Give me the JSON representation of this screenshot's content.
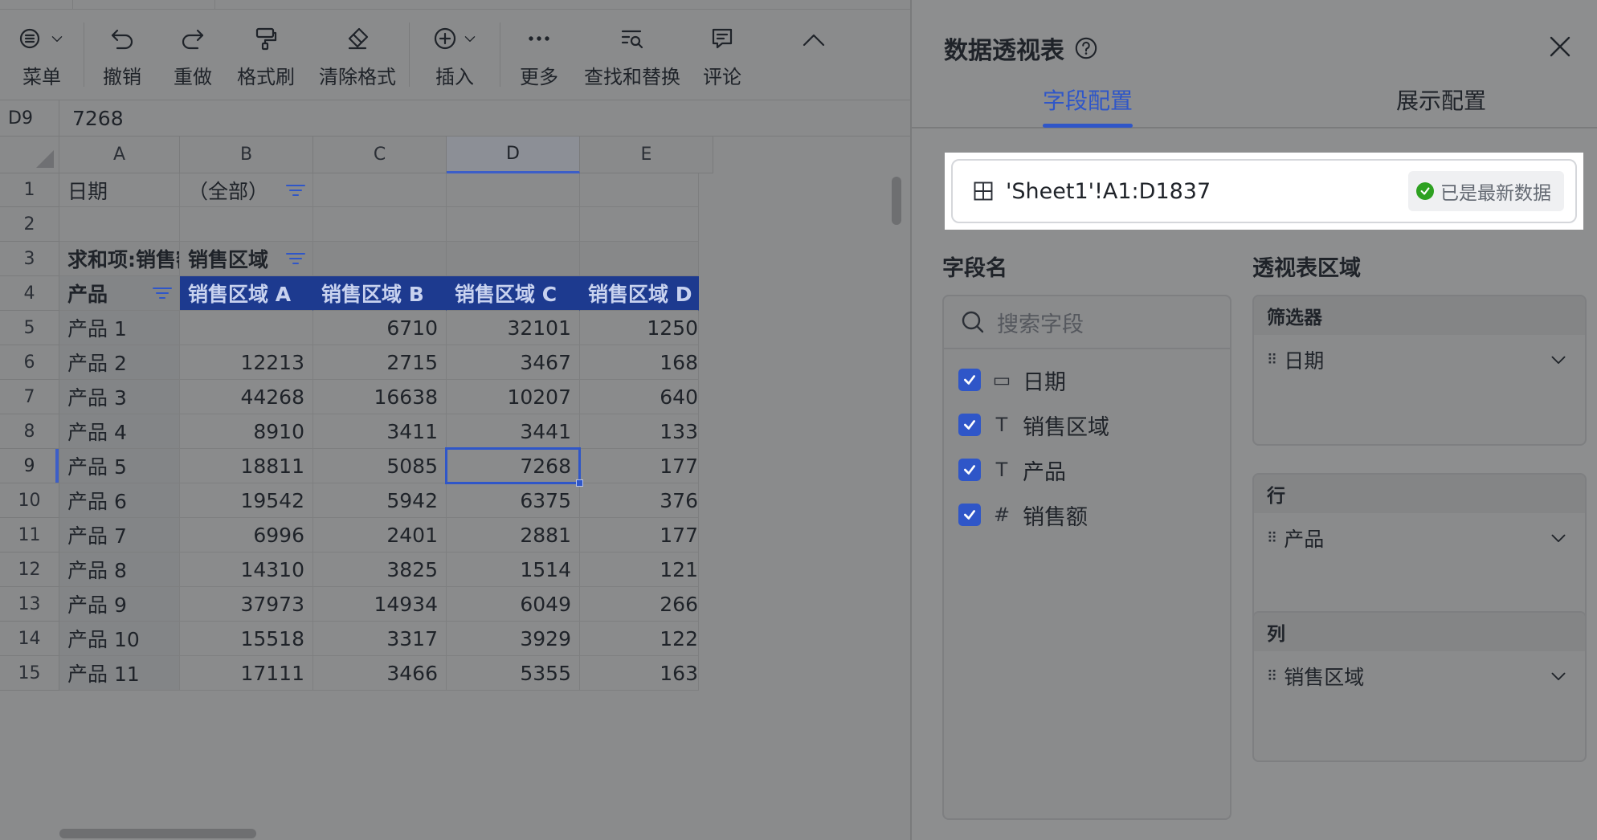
{
  "toolbar": {
    "items": [
      {
        "label": "菜单",
        "icon": "menu-icon"
      },
      {
        "label": "撤销",
        "icon": "undo-icon"
      },
      {
        "label": "重做",
        "icon": "redo-icon"
      },
      {
        "label": "格式刷",
        "icon": "format-painter-icon"
      },
      {
        "label": "清除格式",
        "icon": "eraser-icon"
      },
      {
        "label": "插入",
        "icon": "plus-circle-icon"
      },
      {
        "label": "更多",
        "icon": "more-icon"
      },
      {
        "label": "查找和替换",
        "icon": "find-replace-icon"
      },
      {
        "label": "评论",
        "icon": "comment-icon"
      }
    ]
  },
  "formula_bar": {
    "cell_ref": "D9",
    "value": "7268"
  },
  "grid": {
    "columns": [
      "A",
      "B",
      "C",
      "D",
      "E"
    ],
    "selected_column": "D",
    "selected_row": "9",
    "rows": [
      {
        "n": "1",
        "cells": [
          "日期",
          "（全部）",
          "",
          "",
          ""
        ]
      },
      {
        "n": "2",
        "cells": [
          "",
          "",
          "",
          "",
          ""
        ]
      },
      {
        "n": "3",
        "cells": [
          "求和项:销售额",
          "销售区域",
          "",
          "",
          ""
        ]
      },
      {
        "n": "4",
        "cells": [
          "产品",
          "销售区域 A",
          "销售区域 B",
          "销售区域 C",
          "销售区域 D"
        ]
      },
      {
        "n": "5",
        "cells": [
          "产品 1",
          "",
          "6710",
          "32101",
          "1250"
        ]
      },
      {
        "n": "6",
        "cells": [
          "产品 2",
          "12213",
          "2715",
          "3467",
          "168"
        ]
      },
      {
        "n": "7",
        "cells": [
          "产品 3",
          "44268",
          "16638",
          "10207",
          "640"
        ]
      },
      {
        "n": "8",
        "cells": [
          "产品 4",
          "8910",
          "3411",
          "3441",
          "133"
        ]
      },
      {
        "n": "9",
        "cells": [
          "产品 5",
          "18811",
          "5085",
          "7268",
          "177"
        ]
      },
      {
        "n": "10",
        "cells": [
          "产品 6",
          "19542",
          "5942",
          "6375",
          "376"
        ]
      },
      {
        "n": "11",
        "cells": [
          "产品 7",
          "6996",
          "2401",
          "2881",
          "177"
        ]
      },
      {
        "n": "12",
        "cells": [
          "产品 8",
          "14310",
          "3825",
          "1514",
          "121"
        ]
      },
      {
        "n": "13",
        "cells": [
          "产品 9",
          "37973",
          "14934",
          "6049",
          "266"
        ]
      },
      {
        "n": "14",
        "cells": [
          "产品 10",
          "15518",
          "3317",
          "3929",
          "122"
        ]
      },
      {
        "n": "15",
        "cells": [
          "产品 11",
          "17111",
          "3466",
          "5355",
          "163"
        ]
      }
    ]
  },
  "panel": {
    "title": "数据透视表",
    "tabs": {
      "field_config": "字段配置",
      "display_config": "展示配置"
    },
    "source_range": "'Sheet1'!A1:D1837",
    "source_status": "已是最新数据",
    "field_list_title": "字段名",
    "search_placeholder": "搜索字段",
    "fields": [
      {
        "name": "日期",
        "type_glyph": "▭",
        "type": "date"
      },
      {
        "name": "销售区域",
        "type_glyph": "T",
        "type": "text"
      },
      {
        "name": "产品",
        "type_glyph": "T",
        "type": "text"
      },
      {
        "name": "销售额",
        "type_glyph": "#",
        "type": "number"
      }
    ],
    "area_title": "透视表区域",
    "zones": [
      {
        "title": "筛选器",
        "item": "日期"
      },
      {
        "title": "行",
        "item": "产品"
      },
      {
        "title": "列",
        "item": "销售区域"
      }
    ]
  },
  "colors": {
    "accent": "#2f56c8",
    "header_blue": "#1d3a8f",
    "ok_green": "#2ea121"
  }
}
